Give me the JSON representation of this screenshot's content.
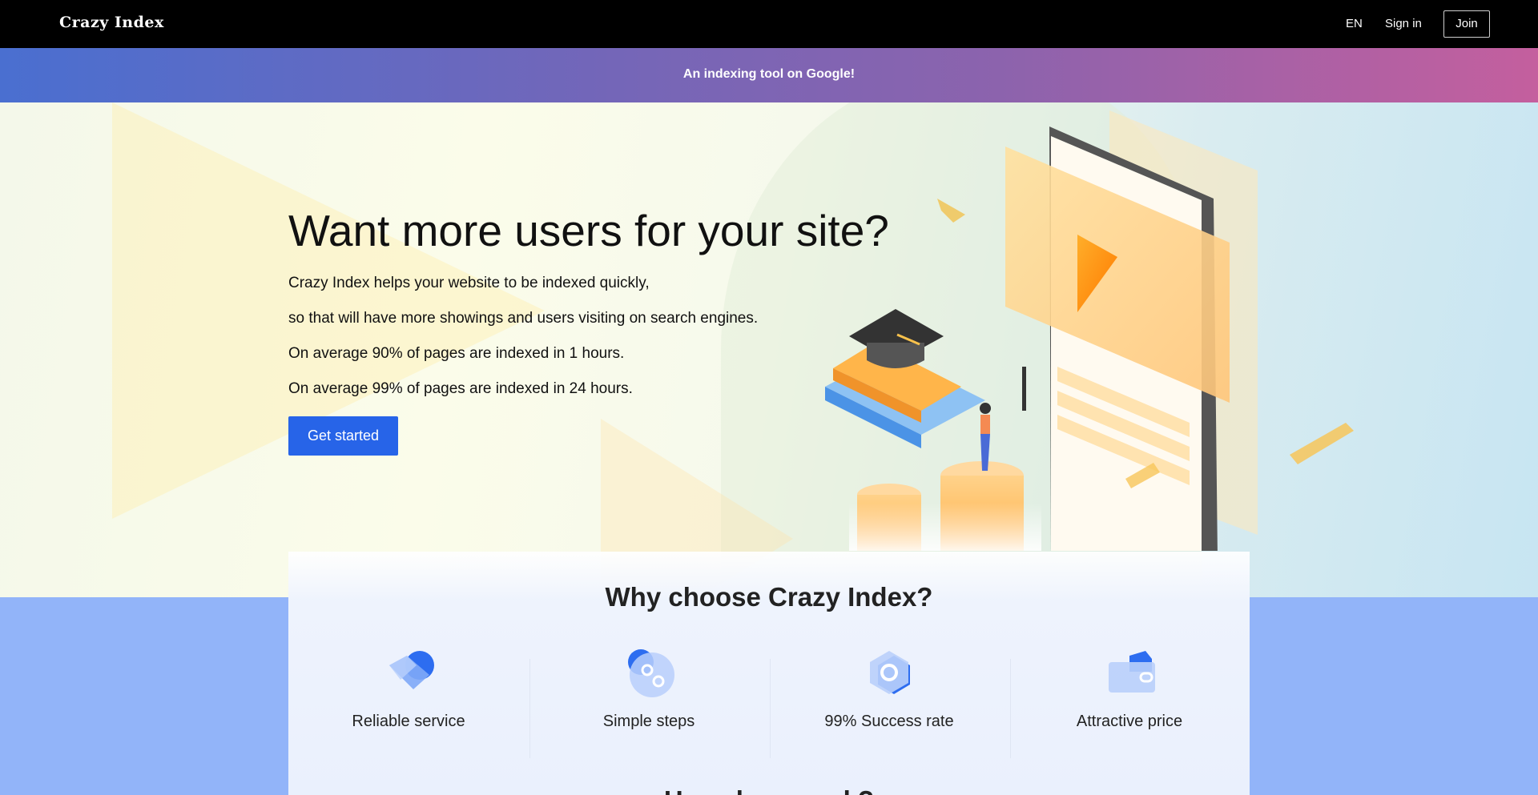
{
  "nav": {
    "brand": "Crazy Index",
    "lang": "EN",
    "sign_in": "Sign in",
    "join": "Join"
  },
  "banner": {
    "text": "An indexing tool on Google!"
  },
  "hero": {
    "title": "Want more users for your site?",
    "lines": [
      "Crazy Index helps your website to be indexed quickly,",
      "so that will have more showings and users visiting on search engines.",
      "On average 90% of pages are indexed in 1 hours.",
      "On average 99% of pages are indexed in 24 hours."
    ],
    "cta": "Get started"
  },
  "why": {
    "title": "Why choose Crazy Index?",
    "features": [
      {
        "label": "Reliable service",
        "icon": "handshake-icon"
      },
      {
        "label": "Simple steps",
        "icon": "steps-icon"
      },
      {
        "label": "99% Success rate",
        "icon": "hexagon-icon"
      },
      {
        "label": "Attractive price",
        "icon": "wallet-icon"
      }
    ],
    "next_section_title": "How does work?"
  },
  "colors": {
    "accent": "#2764e8",
    "nav_bg": "#000000",
    "band_blue": "#92b4f9"
  }
}
